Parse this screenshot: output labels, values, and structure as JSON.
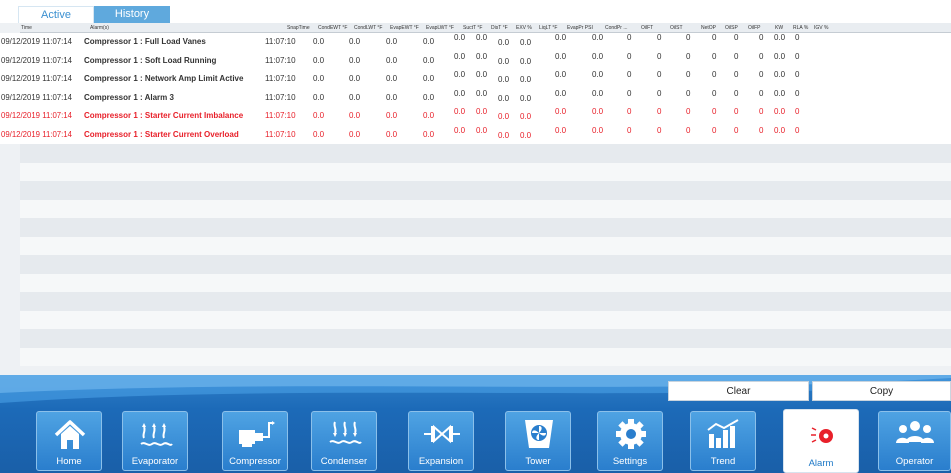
{
  "tabs": [
    {
      "label": "Active",
      "state": "active"
    },
    {
      "label": "History",
      "state": "inactive"
    }
  ],
  "table": {
    "headers": [
      "Time",
      "Alarm(s)",
      "SnapTime",
      "CondEWT °F",
      "CondLWT °F",
      "EvapEWT °F",
      "EvapLWT °F",
      "SuctT °F",
      "DisT °F",
      "EXV %",
      "LiqLT °F",
      "EvapPr PSI",
      "CondPr ...",
      "OilFT",
      "OilST",
      "NetOP",
      "OilSP",
      "OilFP",
      "KW",
      "RLA %",
      "IGV %"
    ],
    "rows": [
      {
        "time": "09/12/2019 11:07:14",
        "alarm": "Compressor 1 : Full Load Vanes",
        "snap": "11:07:10",
        "condewt": "0.0",
        "condlwt": "0.0",
        "evapewt": "0.0",
        "evaplwt": "0.0",
        "suct": "0.0",
        "dist": "0.0",
        "exv": "0.0",
        "liqlt": "0.0",
        "evappr": "0.0",
        "condpr": "0.0",
        "oilft": "0",
        "oilst": "0",
        "netop": "0",
        "oilsp": "0",
        "oilfp": "0",
        "kw": "0",
        "rla": "0.0",
        "igv": "0",
        "status": "normal"
      },
      {
        "time": "09/12/2019 11:07:14",
        "alarm": "Compressor 1 : Soft Load Running",
        "snap": "11:07:10",
        "condewt": "0.0",
        "condlwt": "0.0",
        "evapewt": "0.0",
        "evaplwt": "0.0",
        "suct": "0.0",
        "dist": "0.0",
        "exv": "0.0",
        "liqlt": "0.0",
        "evappr": "0.0",
        "condpr": "0.0",
        "oilft": "0",
        "oilst": "0",
        "netop": "0",
        "oilsp": "0",
        "oilfp": "0",
        "kw": "0",
        "rla": "0.0",
        "igv": "0",
        "status": "normal"
      },
      {
        "time": "09/12/2019 11:07:14",
        "alarm": "Compressor 1 : Network Amp Limit Active",
        "snap": "11:07:10",
        "condewt": "0.0",
        "condlwt": "0.0",
        "evapewt": "0.0",
        "evaplwt": "0.0",
        "suct": "0.0",
        "dist": "0.0",
        "exv": "0.0",
        "liqlt": "0.0",
        "evappr": "0.0",
        "condpr": "0.0",
        "oilft": "0",
        "oilst": "0",
        "netop": "0",
        "oilsp": "0",
        "oilfp": "0",
        "kw": "0",
        "rla": "0.0",
        "igv": "0",
        "status": "normal"
      },
      {
        "time": "09/12/2019 11:07:14",
        "alarm": "Compressor 1 : Alarm 3",
        "snap": "11:07:10",
        "condewt": "0.0",
        "condlwt": "0.0",
        "evapewt": "0.0",
        "evaplwt": "0.0",
        "suct": "0.0",
        "dist": "0.0",
        "exv": "0.0",
        "liqlt": "0.0",
        "evappr": "0.0",
        "condpr": "0.0",
        "oilft": "0",
        "oilst": "0",
        "netop": "0",
        "oilsp": "0",
        "oilfp": "0",
        "kw": "0",
        "rla": "0.0",
        "igv": "0",
        "status": "normal"
      },
      {
        "time": "09/12/2019 11:07:14",
        "alarm": "Compressor 1 : Starter Current Imbalance",
        "snap": "11:07:10",
        "condewt": "0.0",
        "condlwt": "0.0",
        "evapewt": "0.0",
        "evaplwt": "0.0",
        "suct": "0.0",
        "dist": "0.0",
        "exv": "0.0",
        "liqlt": "0.0",
        "evappr": "0.0",
        "condpr": "0.0",
        "oilft": "0",
        "oilst": "0",
        "netop": "0",
        "oilsp": "0",
        "oilfp": "0",
        "kw": "0",
        "rla": "0.0",
        "igv": "0",
        "status": "alarm"
      },
      {
        "time": "09/12/2019 11:07:14",
        "alarm": "Compressor 1 : Starter Current Overload",
        "snap": "11:07:10",
        "condewt": "0.0",
        "condlwt": "0.0",
        "evapewt": "0.0",
        "evaplwt": "0.0",
        "suct": "0.0",
        "dist": "0.0",
        "exv": "0.0",
        "liqlt": "0.0",
        "evappr": "0.0",
        "condpr": "0.0",
        "oilft": "0",
        "oilst": "0",
        "netop": "0",
        "oilsp": "0",
        "oilfp": "0",
        "kw": "0",
        "rla": "0.0",
        "igv": "0",
        "status": "alarm"
      }
    ]
  },
  "actions": {
    "clear_label": "Clear",
    "copy_label": "Copy"
  },
  "nav": [
    {
      "label": "Home",
      "icon": "home-icon"
    },
    {
      "label": "Evaporator",
      "icon": "evaporator-icon"
    },
    {
      "label": "Compressor",
      "icon": "compressor-icon"
    },
    {
      "label": "Condenser",
      "icon": "condenser-icon"
    },
    {
      "label": "Expansion",
      "icon": "expansion-icon"
    },
    {
      "label": "Tower",
      "icon": "tower-icon"
    },
    {
      "label": "Settings",
      "icon": "gear-icon"
    },
    {
      "label": "Trend",
      "icon": "trend-icon"
    },
    {
      "label": "Alarm",
      "icon": "alarm-icon",
      "active": true
    },
    {
      "label": "Operator",
      "icon": "operator-icon"
    }
  ],
  "colors": {
    "accent": "#1f79c7",
    "alarm_text": "#e8202a",
    "nav_bg": "#1c6ab8"
  }
}
